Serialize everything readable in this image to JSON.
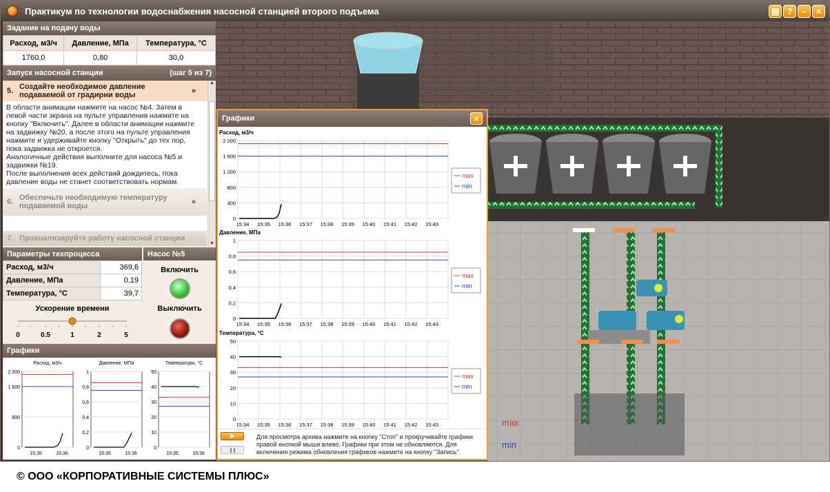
{
  "window": {
    "title": "Практикум по технологии водоснабжения насосной станцией второго подъема",
    "buttons": [
      "▤",
      "?",
      "–",
      "×"
    ]
  },
  "task": {
    "title": "Задание на подачу воды",
    "headers": [
      "Расход, м3/ч",
      "Давление, МПа",
      "Температура, °С"
    ],
    "values": [
      "1760,0",
      "0,80",
      "30,0"
    ]
  },
  "launch": {
    "title": "Запуск насосной станции",
    "step": "(шаг 5 из 7)"
  },
  "steps": {
    "s5_num": "5.",
    "s5": "Создайте необходимое давление подаваемой от градирни воды",
    "s5_desc": "В области анимации нажмите на насос №4. Затем в левой части экрана на пульте управления нажмите на кнопку \"Включить\". Далее в области анимации нажмите на задвижку №20, а после этого на пульте управления нажмите и удерживайте кнопку \"Открыть\" до тех пор, пока задвижка не откроется.\nАналогичные действия выполните для насоса №5 и задвижки №19.\nПосле выполнения всех действий дождитесь, пока давление воды не станет соответствовать нормам.",
    "s6_num": "6.",
    "s6": "Обеспечьте необходимую температуру подаваемой воды",
    "s7_num": "7.",
    "s7": "Проанализируйте работу насосной станции"
  },
  "params": {
    "title": "Параметры техпроцесса",
    "rows": [
      {
        "label": "Расход, м3/ч",
        "value": "369,6"
      },
      {
        "label": "Давление, МПа",
        "value": "0,19"
      },
      {
        "label": "Температура, °С",
        "value": "39,7"
      }
    ]
  },
  "pump": {
    "title": "Насос №5",
    "on": "Включить",
    "off": "Выключить"
  },
  "accel": {
    "title": "Ускорение времени",
    "ticks": [
      "0",
      "0.5",
      "1",
      "2",
      "5"
    ],
    "value": 1
  },
  "mini": {
    "title": "Графики",
    "charts": [
      "Расход, м3/ч",
      "Давление, МПа",
      "Температура, °С"
    ],
    "ticks": [
      "15:35",
      "15:36"
    ]
  },
  "graphs": {
    "title": "Графики",
    "legend_max": "max",
    "legend_min": "min",
    "hint": "Для просмотра архива нажмите на кнопку \"Стоп\" и прокручивайте графики правой кнопкой мыши влево. Графики при этом не обновляются. Для включения режима обновления графиков нажмите на кнопку \"Запись\"."
  },
  "scene": {
    "legend_max": "max",
    "legend_min": "min"
  },
  "copyright": "© ООО «КОРПОРАТИВНЫЕ СИСТЕМЫ ПЛЮС»",
  "chart_data": [
    {
      "type": "line",
      "title": "Расход, м3/ч",
      "x": [
        "15:34",
        "15:35",
        "15:36",
        "15:37",
        "15:38",
        "15:39",
        "15:40",
        "15:41",
        "15:42",
        "15:43"
      ],
      "ylim": [
        0,
        2000
      ],
      "yticks": [
        "0",
        "400",
        "800",
        "1 200",
        "1 600",
        "2 000"
      ],
      "series": [
        {
          "name": "max",
          "color": "#e03030",
          "values": [
            1920
          ]
        },
        {
          "name": "min",
          "color": "#3040e0",
          "values": [
            1600
          ]
        },
        {
          "name": "value",
          "color": "#000000",
          "x_min": [
            0,
            1,
            1.7,
            1.85,
            1.95,
            2.0,
            2.05
          ],
          "y": [
            0,
            0,
            0,
            40,
            150,
            280,
            370
          ]
        }
      ]
    },
    {
      "type": "line",
      "title": "Давление, МПа",
      "x": [
        "15:34",
        "15:35",
        "15:36",
        "15:37",
        "15:38",
        "15:39",
        "15:40",
        "15:41",
        "15:42",
        "15:43"
      ],
      "ylim": [
        0,
        1
      ],
      "yticks": [
        "0",
        "0,2",
        "0,4",
        "0,6",
        "0,8",
        "1"
      ],
      "series": [
        {
          "name": "max",
          "color": "#e03030",
          "values": [
            0.85
          ]
        },
        {
          "name": "min",
          "color": "#3040e0",
          "values": [
            0.75
          ]
        },
        {
          "name": "value",
          "color": "#000000",
          "x_min": [
            0,
            1,
            1.75,
            1.85,
            1.95,
            2.05
          ],
          "y": [
            0,
            0,
            0,
            0.05,
            0.12,
            0.19
          ]
        }
      ]
    },
    {
      "type": "line",
      "title": "Температура, °С",
      "x": [
        "15:34",
        "15:35",
        "15:36",
        "15:37",
        "15:38",
        "15:39",
        "15:40",
        "15:41",
        "15:42",
        "15:43"
      ],
      "ylim": [
        0,
        50
      ],
      "yticks": [
        "0",
        "10",
        "20",
        "30",
        "40",
        "50"
      ],
      "series": [
        {
          "name": "max",
          "color": "#e03030",
          "values": [
            33
          ]
        },
        {
          "name": "min",
          "color": "#3040e0",
          "values": [
            27
          ]
        },
        {
          "name": "value",
          "color": "#000000",
          "x_min": [
            0,
            1,
            1.9,
            2.05
          ],
          "y": [
            40,
            40,
            40,
            39.7
          ]
        }
      ]
    }
  ]
}
